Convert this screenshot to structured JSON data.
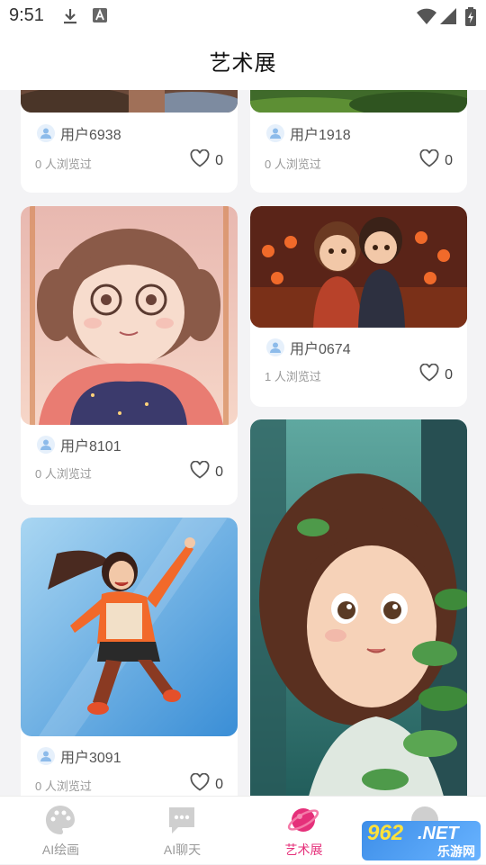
{
  "status_bar": {
    "time": "9:51"
  },
  "header": {
    "title": "艺术展"
  },
  "feed": {
    "cards": [
      {
        "user": "用户6938",
        "views": "0 人浏览过",
        "likes": "0"
      },
      {
        "user": "用户1918",
        "views": "0 人浏览过",
        "likes": "0"
      },
      {
        "user": "用户8101",
        "views": "0 人浏览过",
        "likes": "0"
      },
      {
        "user": "用户0674",
        "views": "1 人浏览过",
        "likes": "0"
      },
      {
        "user": "用户3091",
        "views": "0 人浏览过",
        "likes": "0"
      }
    ]
  },
  "tabbar": {
    "tabs": [
      {
        "label": "AI绘画",
        "icon": "palette-icon"
      },
      {
        "label": "AI聊天",
        "icon": "chat-icon"
      },
      {
        "label": "艺术展",
        "icon": "planet-icon",
        "active": true
      },
      {
        "label": "",
        "icon": "message-icon"
      }
    ]
  },
  "watermark": {
    "brand": "962",
    "net": ".NET",
    "site": "乐游网"
  },
  "colors": {
    "accent": "#e5307a",
    "muted": "#999999",
    "avatar_bg": "#e6f0fb"
  }
}
